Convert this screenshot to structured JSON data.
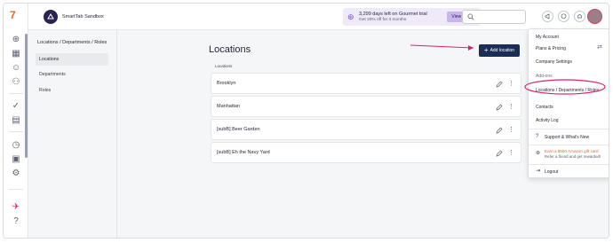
{
  "app": {
    "logo_text": "7",
    "org_name": "SmartTab Sandbox"
  },
  "trial_banner": {
    "line1": "3,299 days left on Gourmet trial",
    "line2": "Get 20% off for 3 months",
    "button": "View Plans"
  },
  "search": {
    "placeholder": ""
  },
  "sidebar": {
    "title": "Locations / Departments / Roles",
    "items": [
      {
        "label": "Locations",
        "active": true
      },
      {
        "label": "Departments",
        "active": false
      },
      {
        "label": "Roles",
        "active": false
      }
    ]
  },
  "main": {
    "heading": "Locations",
    "add_button": "Add location",
    "list_label": "Locations",
    "locations": [
      {
        "name": "Brooklyn"
      },
      {
        "name": "Manhattan"
      },
      {
        "name": "[subB] Beer Garden"
      },
      {
        "name": "[subB] Eh the Navy Yard"
      }
    ]
  },
  "account_menu": {
    "items": [
      "My Account",
      "Plans & Pricing",
      "Company Settings",
      "Add-ons",
      "Locations / Departments / Roles",
      "Contacts",
      "Activity Log",
      "Support & What's New"
    ],
    "promo_line1": "Earn a $500 Amazon gift card",
    "promo_line2": "Refer a friend and get rewarded!",
    "logout": "Logout"
  },
  "colors": {
    "primary": "#1b2c55",
    "annotation": "#d6246e",
    "promo": "#e8642c",
    "trial_bg": "#efe9f8"
  }
}
